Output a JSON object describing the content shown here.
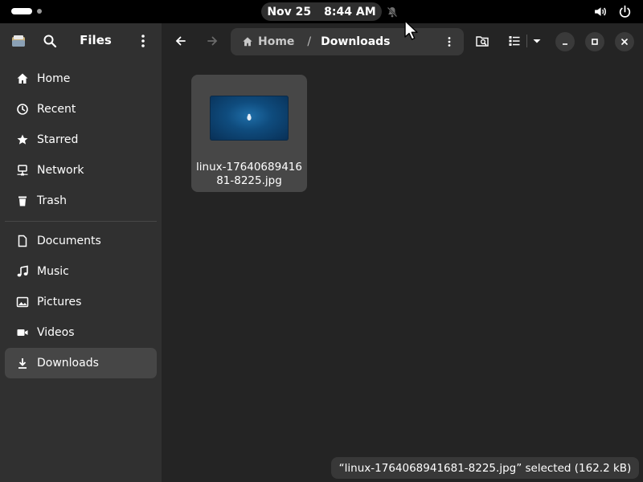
{
  "topbar": {
    "date": "Nov 25",
    "time": "8:44 AM",
    "icons": [
      "notifications-disabled-icon",
      "volume-icon",
      "power-icon"
    ]
  },
  "app": {
    "title": "Files"
  },
  "sidebar": {
    "places": [
      {
        "label": "Home",
        "icon": "home-icon"
      },
      {
        "label": "Recent",
        "icon": "clock-icon"
      },
      {
        "label": "Starred",
        "icon": "star-icon"
      },
      {
        "label": "Network",
        "icon": "network-icon"
      },
      {
        "label": "Trash",
        "icon": "trash-icon"
      }
    ],
    "bookmarks": [
      {
        "label": "Documents",
        "icon": "document-icon"
      },
      {
        "label": "Music",
        "icon": "music-icon"
      },
      {
        "label": "Pictures",
        "icon": "picture-icon"
      },
      {
        "label": "Videos",
        "icon": "video-icon"
      },
      {
        "label": "Downloads",
        "icon": "download-icon",
        "selected": true
      }
    ]
  },
  "pathbar": {
    "home": "Home",
    "separator": "/",
    "current": "Downloads"
  },
  "files": [
    {
      "name": "linux-1764068941681-8225.jpg",
      "selected": true
    }
  ],
  "status": {
    "text": "“linux-1764068941681-8225.jpg” selected  (162.2 kB)"
  },
  "colors": {
    "window_bg": "#242424",
    "sidebar_bg": "#303030",
    "selected_bg": "#464646",
    "topbar_bg": "#000000"
  }
}
